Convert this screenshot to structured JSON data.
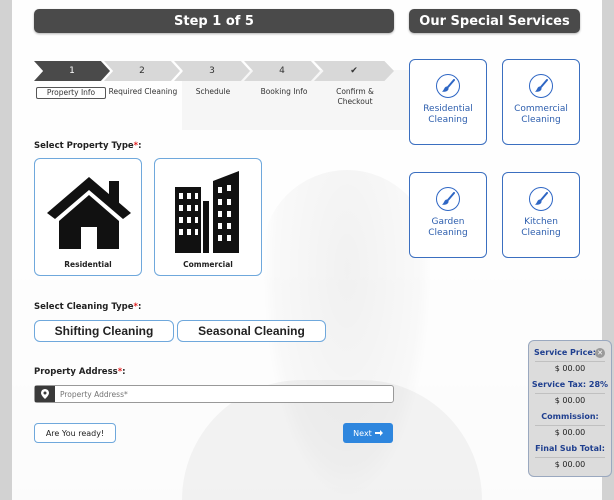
{
  "header": {
    "step_title": "Step 1 of 5",
    "services_title": "Our Special Services"
  },
  "stepper": {
    "steps": [
      {
        "number": "1",
        "label": "Property Info",
        "active": true
      },
      {
        "number": "2",
        "label": "Required Cleaning",
        "active": false
      },
      {
        "number": "3",
        "label": "Schedule",
        "active": false
      },
      {
        "number": "4",
        "label": "Booking Info",
        "active": false
      },
      {
        "number": "✔",
        "label_line1": "Confirm &",
        "label_line2": "Checkout",
        "active": false
      }
    ]
  },
  "property": {
    "label": "Select Property Type",
    "required_mark": "*",
    "colon": ":",
    "options": [
      {
        "name": "Residential",
        "icon": "house-icon"
      },
      {
        "name": "Commercial",
        "icon": "building-icon"
      }
    ]
  },
  "cleaning": {
    "label": "Select Cleaning Type",
    "required_mark": "*",
    "colon": ":",
    "options": [
      "Shifting Cleaning",
      "Seasonal Cleaning"
    ]
  },
  "address": {
    "label": "Property Address",
    "required_mark": "*",
    "colon": ":",
    "placeholder": "Property Address*",
    "icon": "map-marker-icon"
  },
  "actions": {
    "ready_label": "Are You ready!",
    "next_label": "Next",
    "next_icon": "arrow-right-icon"
  },
  "services": [
    {
      "line1": "Residential",
      "line2": "Cleaning",
      "icon": "brush-icon"
    },
    {
      "line1": "Commercial",
      "line2": "Cleaning",
      "icon": "brush-icon"
    },
    {
      "line1": "Garden",
      "line2": "Cleaning",
      "icon": "brush-icon"
    },
    {
      "line1": "Kitchen",
      "line2": "Cleaning",
      "icon": "brush-icon"
    }
  ],
  "price_panel": {
    "service_price_label": "Service Price:",
    "service_price_value": "$ 00.00",
    "service_tax_label": "Service Tax: 28%",
    "service_tax_value": "$ 00.00",
    "commission_label": "Commission:",
    "commission_value": "$ 00.00",
    "final_label": "Final Sub Total:",
    "final_value": "$ 00.00",
    "close_icon": "close-icon"
  },
  "colors": {
    "accent_blue": "#2e86de",
    "card_border": "#6fa8dc",
    "service_blue": "#3b6fc0",
    "required_red": "#e02020",
    "header_dark": "#4a4a4a"
  }
}
